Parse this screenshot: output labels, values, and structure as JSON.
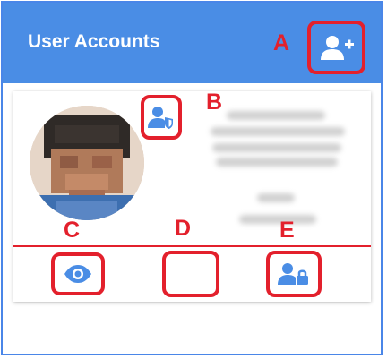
{
  "header": {
    "title": "User Accounts",
    "add_user_icon": "person-add-icon"
  },
  "callout_labels": {
    "a": "A",
    "b": "B",
    "c": "C",
    "d": "D",
    "e": "E"
  },
  "card": {
    "role_badge_icon": "person-shield-icon",
    "actions": [
      {
        "icon": "eye-icon"
      },
      {
        "icon": "blank"
      },
      {
        "icon": "person-lock-icon"
      }
    ]
  },
  "colors": {
    "header_bg": "#4a8de5",
    "callout": "#e3202c",
    "icon": "#4a8de5"
  }
}
